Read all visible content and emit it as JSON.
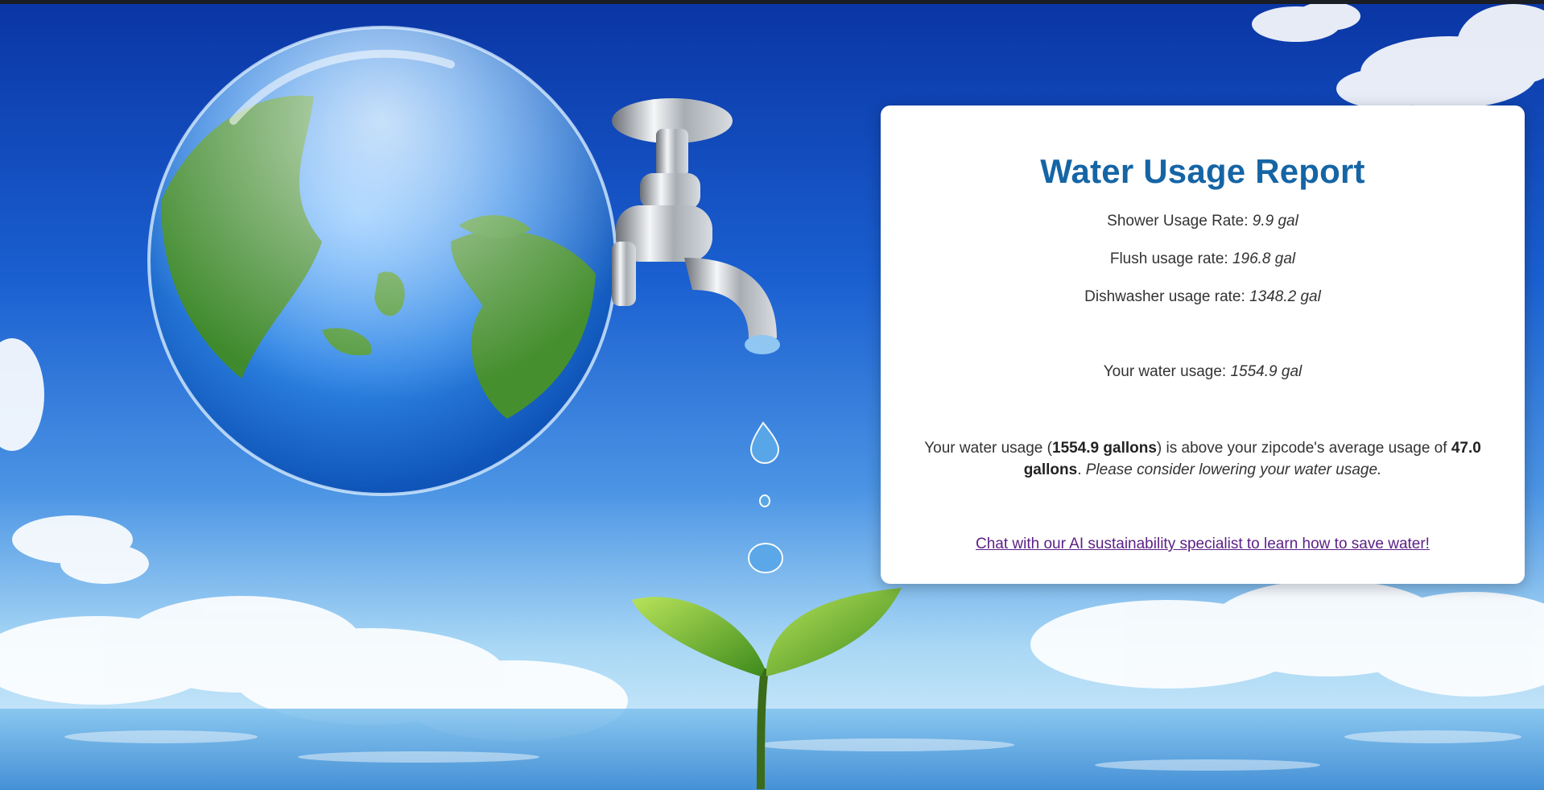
{
  "report": {
    "title": "Water Usage Report",
    "rates": [
      {
        "label": "Shower Usage Rate: ",
        "value": "9.9 gal"
      },
      {
        "label": "Flush usage rate: ",
        "value": "196.8 gal"
      },
      {
        "label": "Dishwasher usage rate: ",
        "value": "1348.2 gal"
      }
    ],
    "total": {
      "label": "Your water usage: ",
      "value": "1554.9 gal"
    },
    "comparison": {
      "prefix": "Your water usage (",
      "usage": "1554.9 gallons",
      "middle": ") is above your zipcode's average usage of ",
      "average": "47.0 gallons",
      "period": ". ",
      "advice": "Please consider lowering your water usage."
    },
    "chat_link": "Chat with our AI sustainability specialist to learn how to save water!"
  },
  "background": {
    "sky_top": "#0a35a4",
    "sky_bottom": "#9fd3f3",
    "icons": [
      "globe-bubble",
      "water-faucet",
      "water-droplets",
      "seedling",
      "clouds",
      "water-surface"
    ]
  }
}
